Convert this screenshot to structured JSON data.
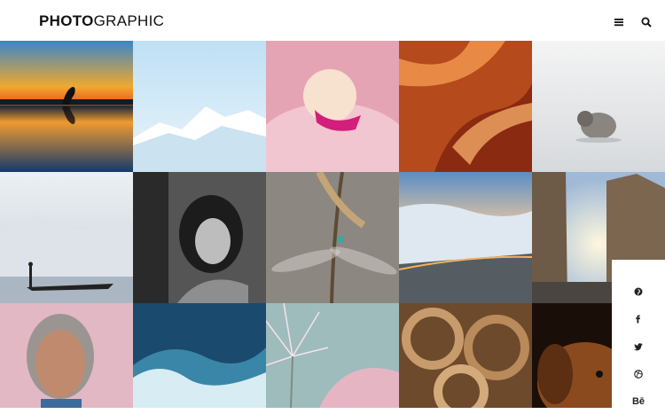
{
  "brand": {
    "bold": "PHOTO",
    "light": "GRAPHIC"
  },
  "header": {
    "menu_icon": "hamburger-menu-icon",
    "search_icon": "search-icon"
  },
  "gallery": {
    "photos": [
      "yoga-sunset-lake",
      "snowy-mountains",
      "pink-flamingo",
      "red-rock-canyon",
      "small-bird-on-snow",
      "fisherman-on-misty-lake",
      "girl-black-white-portrait",
      "dragonfly-on-grass",
      "sea-of-clouds-road",
      "city-buildings-sunlight",
      "elderly-woman-portrait",
      "ocean-waves",
      "pink-flower-bloom",
      "coiled-ropes",
      "brown-dog"
    ]
  },
  "social": [
    {
      "name": "pinterest",
      "icon": "pinterest-icon"
    },
    {
      "name": "facebook",
      "icon": "facebook-icon"
    },
    {
      "name": "twitter",
      "icon": "twitter-icon"
    },
    {
      "name": "dribbble",
      "icon": "dribbble-icon"
    },
    {
      "name": "behance",
      "icon": "behance-icon",
      "label": "Bē"
    }
  ],
  "colors": {
    "text": "#111111",
    "background": "#ffffff"
  }
}
